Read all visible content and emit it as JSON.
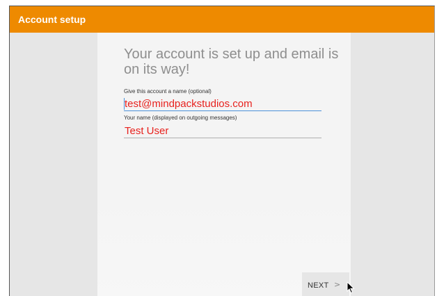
{
  "appbar": {
    "title": "Account setup",
    "color": "#ee8a00"
  },
  "main": {
    "headline": "Your account is set up and email is on its way!",
    "fields": [
      {
        "label": "Give this account a name (optional)",
        "value": "test@mindpackstudios.com",
        "focused": true
      },
      {
        "label": "Your name (displayed on outgoing messages)",
        "value": "Test User",
        "focused": false
      }
    ],
    "value_color": "#e8211d"
  },
  "footer": {
    "next_label": "NEXT",
    "next_icon": "chevron-right-icon",
    "next_glyph": ">"
  },
  "cursor": {
    "icon": "mouse-pointer-icon"
  }
}
